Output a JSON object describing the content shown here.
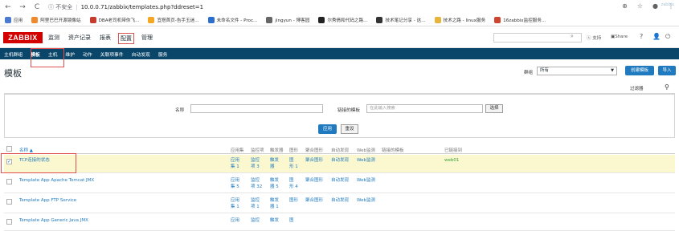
{
  "browser": {
    "nav": {
      "back": "←",
      "forward": "→",
      "reload": "C"
    },
    "security_label": "ⓘ 不安全",
    "url": "10.0.0.71/zabbix/templates.php?ddreset=1",
    "right_icons": [
      "⊕",
      "☆",
      "●",
      "⋮"
    ]
  },
  "bookmarks": [
    {
      "label": "应用",
      "color": "#4a7bd0"
    },
    {
      "label": "阿里巴巴开源镜像站",
      "color": "#f08a2a"
    },
    {
      "label": "DBA老司机带你飞...",
      "color": "#c53b2e"
    },
    {
      "label": "宜搭首页-告手玉迷...",
      "color": "#f5a623"
    },
    {
      "label": "未命名文件 - Proc...",
      "color": "#2a6fd0"
    },
    {
      "label": "jingyun - 博客园",
      "color": "#666666"
    },
    {
      "label": "尔秀倩和代码之路...",
      "color": "#222222"
    },
    {
      "label": "技术笔记分享 - 这...",
      "color": "#333333"
    },
    {
      "label": "技术之路 - linux服务",
      "color": "#e8b53a"
    },
    {
      "label": "16zabbix监控服务...",
      "color": "#d0452f"
    }
  ],
  "header": {
    "logo": "ZABBIX",
    "menu": [
      "监测",
      "资产记录",
      "报表",
      "配置",
      "管理"
    ],
    "active_menu": "配置",
    "support": "支持",
    "share": "Share",
    "icons": [
      "?",
      "👤",
      "⏻"
    ]
  },
  "submenu": {
    "items": [
      "主机群组",
      "模板",
      "主机",
      "维护",
      "动作",
      "关联项事件",
      "自动发现",
      "服务"
    ],
    "active": "模板",
    "right": "zabbix"
  },
  "page": {
    "title": "模板",
    "group_label": "群组",
    "group_value": "所有",
    "create_button": "创建模板",
    "import_button": "导入"
  },
  "filter": {
    "tab_label": "过滤器",
    "name_label": "名称",
    "name_value": "",
    "linked_label": "链接的模板",
    "linked_placeholder": "在此输入搜索",
    "select_button": "选择",
    "apply_button": "应用",
    "reset_button": "重设"
  },
  "table": {
    "columns": [
      "名称 ▲",
      "应用集",
      "监控项",
      "触发器",
      "图形",
      "聚合图形",
      "自动发现",
      "Web监测",
      "链接的模板",
      "已链接到"
    ],
    "rows": [
      {
        "name": "TCP连接的状态",
        "checked": true,
        "highlight": true,
        "apps": [
          "应用",
          "集 1"
        ],
        "items": [
          "监控",
          "项 3"
        ],
        "triggers": [
          "触发",
          "器"
        ],
        "graphs": [
          "图",
          "形 1"
        ],
        "screens": "聚合图形",
        "discovery": "自动发现",
        "web": "Web监测",
        "linked": "",
        "linked_to": "web01"
      },
      {
        "name": "Template App Apache Tomcat JMX",
        "checked": false,
        "highlight": false,
        "apps": [
          "应用",
          "集 5"
        ],
        "items": [
          "监控",
          "项 32"
        ],
        "triggers": [
          "触发",
          "器 5"
        ],
        "graphs": [
          "图",
          "形 4"
        ],
        "screens": "聚合图形",
        "discovery": "自动发现",
        "web": "Web监测",
        "linked": "",
        "linked_to": ""
      },
      {
        "name": "Template App FTP Service",
        "checked": false,
        "highlight": false,
        "apps": [
          "应用",
          "集 1"
        ],
        "items": [
          "监控",
          "项 1"
        ],
        "triggers": [
          "触发",
          "器 1"
        ],
        "graphs": [
          "图形",
          ""
        ],
        "screens": "聚合图形",
        "discovery": "自动发现",
        "web": "Web监测",
        "linked": "",
        "linked_to": ""
      },
      {
        "name": "Template App Generic Java JMX",
        "checked": false,
        "highlight": false,
        "apps": [
          "应用",
          ""
        ],
        "items": [
          "监控",
          ""
        ],
        "triggers": [
          "触发",
          ""
        ],
        "graphs": [
          "图",
          ""
        ],
        "screens": "",
        "discovery": "",
        "web": "",
        "linked": "",
        "linked_to": ""
      }
    ]
  }
}
